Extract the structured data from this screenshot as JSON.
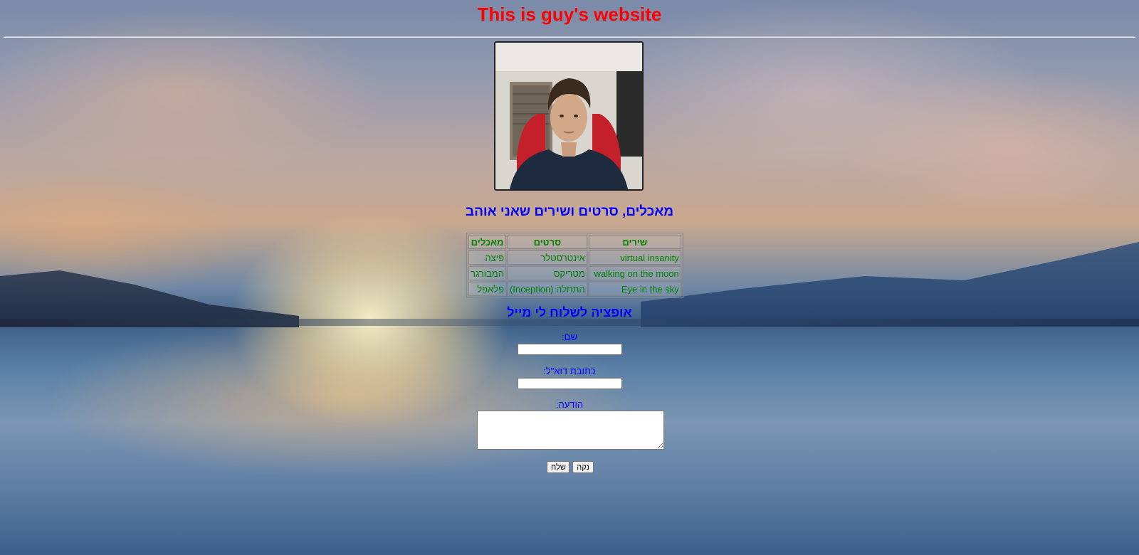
{
  "header": {
    "title": "This is guy's website"
  },
  "portrait": {
    "icon": "profile-photo"
  },
  "favorites": {
    "heading": "מאכלים, סרטים ושירים שאני אוהב",
    "columns": {
      "songs": "שירים",
      "movies": "סרטים",
      "foods": "מאכלים"
    },
    "rows": [
      {
        "song": "virtual insanity",
        "movie": "אינטרסטלר",
        "food": "פיצה"
      },
      {
        "song": "walking on the moon",
        "movie": "מטריקס",
        "food": "המבורגר"
      },
      {
        "song": "Eye in the sky",
        "movie": "התחלה (Inception)",
        "food": "פלאפל"
      }
    ]
  },
  "contact": {
    "heading": "אופציה לשלוח לי מייל",
    "name_label": "שם:",
    "email_label": "כתובת דוא\"ל:",
    "message_label": "הודעה:",
    "name_value": "",
    "email_value": "",
    "message_value": "",
    "send_label": "שלח",
    "clear_label": "נקה"
  },
  "colors": {
    "title": "#ff0000",
    "headings": "#0000ff",
    "table_text": "#008000"
  }
}
